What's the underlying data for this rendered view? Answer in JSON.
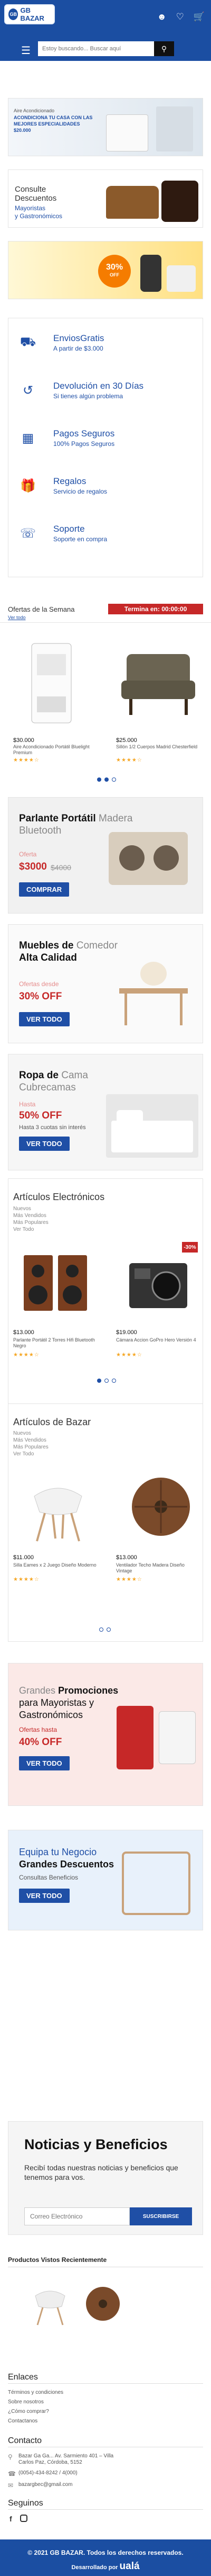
{
  "header": {
    "logo_text": "GB BAZAR",
    "logo_badge": "GB",
    "search_placeholder": "Estoy buscando... Buscar aquí",
    "icons": [
      "user-icon",
      "heart-icon",
      "cart-icon"
    ],
    "accent_color": "#1b4ea2"
  },
  "banners": {
    "b1_small": "Aire Acondicionado",
    "b1_title": "ACONDICIONA TU CASA CON LAS MEJORES ESPECIALIDADES $20.000",
    "b2_line1": "Consulte",
    "b2_line2": "Descuentos",
    "b2_line3": "Mayoristas",
    "b2_line4": "y Gastronómicos",
    "b3_percent": "30%",
    "b3_off": "OFF"
  },
  "features": [
    {
      "title": "EnviosGratis",
      "sub": "A partir de $3.000",
      "icon": "truck-icon"
    },
    {
      "title": "Devolución en 30 Días",
      "sub": "Si tienes algún problema",
      "icon": "return-icon"
    },
    {
      "title": "Pagos Seguros",
      "sub": "100% Pagos Seguros",
      "icon": "card-icon"
    },
    {
      "title": "Regalos",
      "sub": "Servicio de regalos",
      "icon": "gift-icon"
    },
    {
      "title": "Soporte",
      "sub": "Soporte en compra",
      "icon": "headset-icon"
    }
  ],
  "ofertas": {
    "title": "Ofertas de la Semana",
    "sub": "Ver todo",
    "timer": "Termina en: 00:00:00",
    "products": [
      {
        "price": "$30.000",
        "name": "Aire Acondicionado Portátil Bluelight Premium",
        "stars": "★★★★☆"
      },
      {
        "price": "$25.000",
        "name": "Sillón 1/2 Cuerpos Madrid Chesterfield",
        "stars": "★★★★☆"
      }
    ]
  },
  "promo1": {
    "title_bold": "Parlante Portátil",
    "title_light": "Madera",
    "title_line2": "Bluetooth",
    "label": "Oferta",
    "price": "$3000",
    "old_price": "$4000",
    "button": "COMPRAR"
  },
  "promo2": {
    "title_bold": "Muebles de",
    "title_light": "Comedor",
    "title_line2": "Alta Calidad",
    "label": "Ofertas desde",
    "big": "30% OFF",
    "button": "VER TODO"
  },
  "promo3": {
    "title_bold": "Ropa de",
    "title_light": "Cama",
    "title_line2": "Cubrecamas",
    "label": "Hasta",
    "big": "50% OFF",
    "sub": "Hasta 3 cuotas sin interés",
    "button": "VER TODO"
  },
  "cat1": {
    "title": "Artículos Electrónicos",
    "links": [
      "Nuevos",
      "Más Vendidos",
      "Más Populares",
      "Ver Todo"
    ],
    "products": [
      {
        "price": "$13.000",
        "name": "Parlante Portátil 2 Torres Hifi Bluetooth Negro",
        "stars": "★★★★☆"
      },
      {
        "price": "$19.000",
        "name": "Cámara Accion GoPro Hero Versión 4",
        "stars": "★★★★☆",
        "badge": "-30%"
      }
    ]
  },
  "cat2": {
    "title": "Artículos de Bazar",
    "links": [
      "Nuevos",
      "Más Vendidos",
      "Más Populares",
      "Ver Todo"
    ],
    "products": [
      {
        "price": "$11.000",
        "name": "Silla Eames x 2 Juego Diseño Moderno",
        "stars": "★★★★☆"
      },
      {
        "price": "$13.000",
        "name": "Ventilador Techo Madera Diseño Vintage",
        "stars": "★★★★☆"
      }
    ]
  },
  "promo4": {
    "title_light": "Grandes",
    "title_bold": "Promociones",
    "line2": "para Mayoristas y",
    "line3": "Gastronómicos",
    "label": "Ofertas hasta",
    "big": "40% OFF",
    "button": "VER TODO"
  },
  "promo5": {
    "title_light": "Equipa tu Negocio",
    "title_bold": "Grandes Descuentos",
    "sub": "Consultas Beneficios",
    "button": "VER TODO"
  },
  "newsletter": {
    "title": "Noticias y Beneficios",
    "sub": "Recibí todas nuestras noticias y beneficios que tenemos para vos.",
    "placeholder": "Correo Electrónico",
    "button": "SUSCRIBIRSE"
  },
  "recent": {
    "title": "Productos Vistos Recientemente"
  },
  "footer": {
    "links_title": "Enlaces",
    "links": [
      "Términos y condiciones",
      "Sobre nosotros",
      "¿Cómo comprar?",
      "Contactanos"
    ],
    "contact_title": "Contacto",
    "address": "Bazar Ga Ga... Av. Sarmiento 401 – Villa Carlos Paz, Córdoba, 5152",
    "phone": "(0054)-434-8242 / 4(000)",
    "email": "bazargbec@gmail.com",
    "follow_title": "Seguinos",
    "copyright": "© 2021 GB BAZAR. Todos los derechos reservados.",
    "dev": "Desarrollado por",
    "dev_brand": "ualá"
  }
}
